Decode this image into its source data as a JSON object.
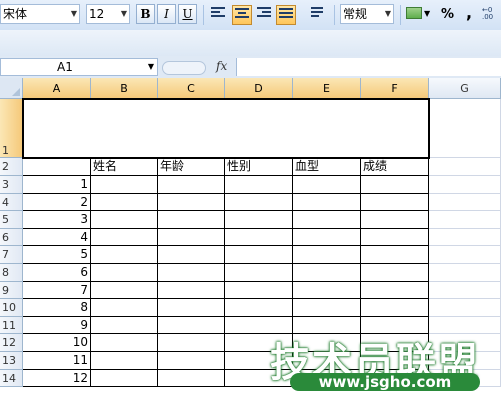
{
  "ribbon": {
    "font_name": "宋体",
    "font_size": "12",
    "bold_label": "B",
    "italic_label": "I",
    "underline_label": "U",
    "number_format": "常规",
    "percent_label": "%",
    "comma_label": ","
  },
  "formula_bar": {
    "name_box": "A1",
    "fx_label": "fx",
    "formula": ""
  },
  "columns": [
    "A",
    "B",
    "C",
    "D",
    "E",
    "F",
    "G"
  ],
  "rows": [
    "1",
    "2",
    "3",
    "4",
    "5",
    "6",
    "7",
    "8",
    "9",
    "10",
    "11",
    "12",
    "13",
    "14"
  ],
  "table": {
    "headers": [
      "姓名",
      "年龄",
      "性别",
      "血型",
      "成绩"
    ],
    "numbers": [
      "1",
      "2",
      "3",
      "4",
      "5",
      "6",
      "7",
      "8",
      "9",
      "10",
      "11",
      "12"
    ]
  },
  "watermark": {
    "brand": "技术员联盟",
    "url": "www.jsgho.com"
  },
  "colors": {
    "ribbon_bg": "#d2e2f5",
    "header_selected": "#f5c97a",
    "watermark_green": "#2a8a3a"
  }
}
